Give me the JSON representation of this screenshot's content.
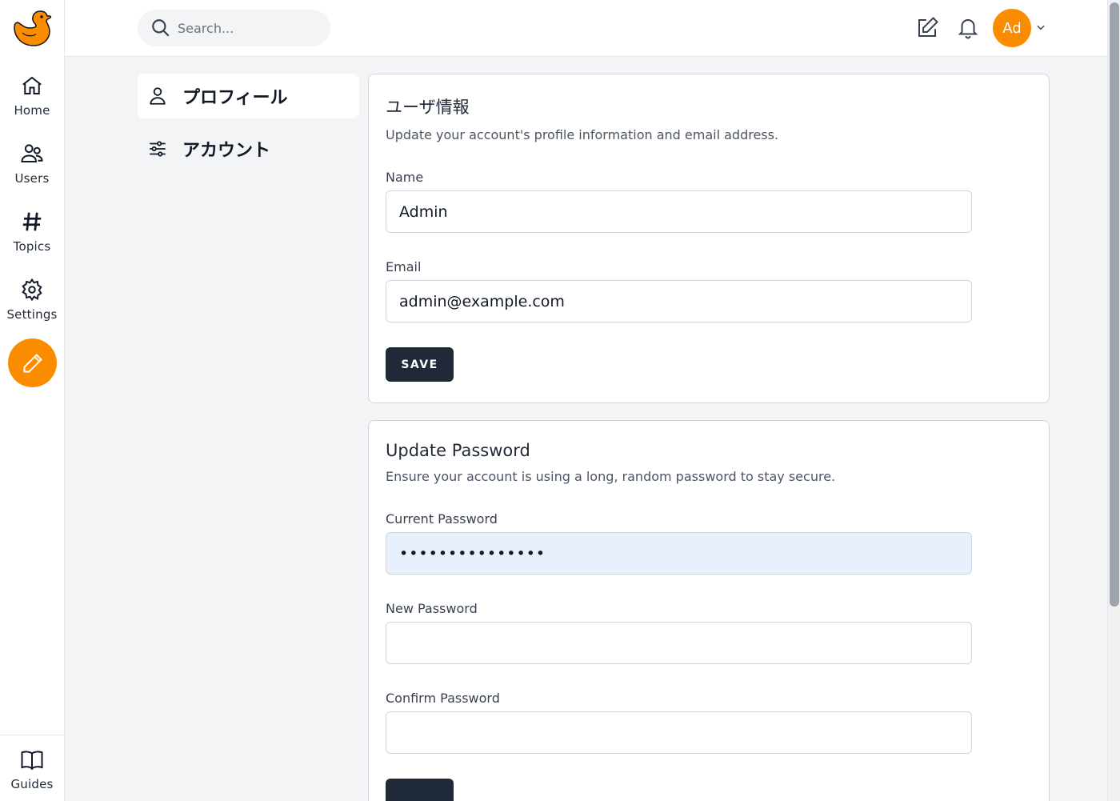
{
  "rail": {
    "items": [
      {
        "label": "Home",
        "icon": "home-icon"
      },
      {
        "label": "Users",
        "icon": "users-icon"
      },
      {
        "label": "Topics",
        "icon": "hash-icon"
      },
      {
        "label": "Settings",
        "icon": "gear-icon"
      }
    ],
    "guides_label": "Guides"
  },
  "topbar": {
    "search_placeholder": "Search...",
    "avatar_initials": "Ad"
  },
  "settings_nav": {
    "items": [
      {
        "label": "プロフィール",
        "active": true
      },
      {
        "label": "アカウント",
        "active": false
      }
    ]
  },
  "profile_card": {
    "title": "ユーザ情報",
    "description": "Update your account's profile information and email address.",
    "name_label": "Name",
    "name_value": "Admin",
    "email_label": "Email",
    "email_value": "admin@example.com",
    "save_label": "SAVE"
  },
  "password_card": {
    "title": "Update Password",
    "description": "Ensure your account is using a long, random password to stay secure.",
    "current_label": "Current Password",
    "current_value": "•••••••••••••••",
    "new_label": "New Password",
    "new_value": "",
    "confirm_label": "Confirm Password",
    "confirm_value": ""
  },
  "colors": {
    "accent": "#fb8c00",
    "button_dark": "#1f2937",
    "autofill_bg": "#e8f0fe"
  }
}
